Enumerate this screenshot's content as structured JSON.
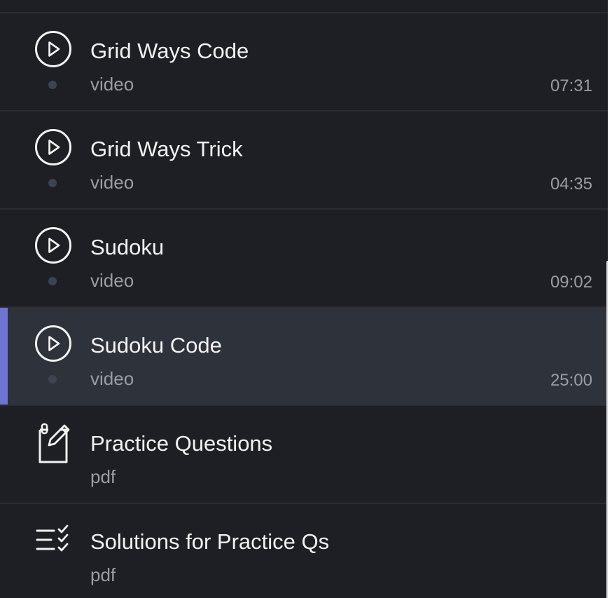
{
  "items": [
    {
      "title": "Grid Ways Code",
      "type": "video",
      "duration": "07:31",
      "icon": "play-circle-icon",
      "active": false
    },
    {
      "title": "Grid Ways Trick",
      "type": "video",
      "duration": "04:35",
      "icon": "play-circle-icon",
      "active": false
    },
    {
      "title": "Sudoku",
      "type": "video",
      "duration": "09:02",
      "icon": "play-circle-icon",
      "active": false
    },
    {
      "title": "Sudoku Code",
      "type": "video",
      "duration": "25:00",
      "icon": "play-circle-icon",
      "active": true
    },
    {
      "title": "Practice Questions",
      "type": "pdf",
      "icon": "notepad-pen-icon",
      "active": false
    },
    {
      "title": "Solutions for Practice Qs",
      "type": "pdf",
      "icon": "checklist-icon",
      "active": false
    }
  ],
  "colors": {
    "background": "#1e1f25",
    "active_background": "#2e323a",
    "active_accent": "#6e74d4",
    "divider": "#2b2d33",
    "title_text": "#f2f2f2",
    "secondary_text": "#9a9da3"
  }
}
